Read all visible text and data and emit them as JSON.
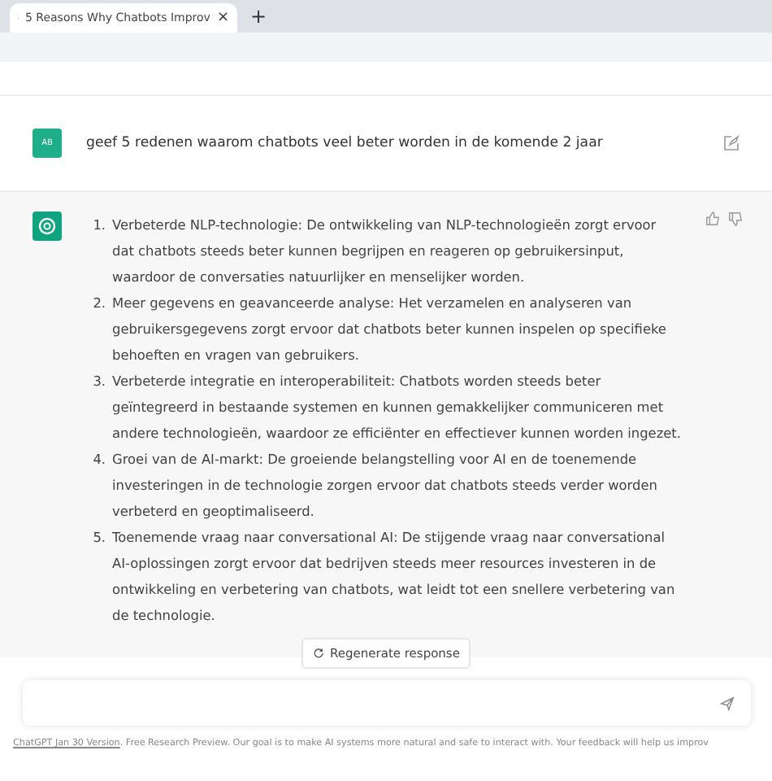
{
  "tab": {
    "title": "5 Reasons Why Chatbots Improv",
    "close": "×",
    "new_tab": "+"
  },
  "user_message": {
    "avatar": "AB",
    "text": "geef 5 redenen waarom chatbots veel beter worden in de komende 2 jaar"
  },
  "answer": {
    "items": [
      {
        "number": "1.",
        "text": "Verbeterde NLP-technologie: De ontwikkeling van NLP-technologieën zorgt ervoor dat chatbots steeds beter kunnen begrijpen en reageren op gebruikersinput, waardoor de conversaties natuurlijker en menselijker worden."
      },
      {
        "number": "2.",
        "text": "Meer gegevens en geavanceerde analyse: Het verzamelen en analyseren van gebruikersgegevens zorgt ervoor dat chatbots beter kunnen inspelen op specifieke behoeften en vragen van gebruikers."
      },
      {
        "number": "3.",
        "text": "Verbeterde integratie en interoperabiliteit: Chatbots worden steeds beter geïntegreerd in bestaande systemen en kunnen gemakkelijker communiceren met andere technologieën, waardoor ze efficiënter en effectiever kunnen worden ingezet."
      },
      {
        "number": "4.",
        "text": "Groei van de AI-markt: De groeiende belangstelling voor AI en de toenemende investeringen in de technologie zorgen ervoor dat chatbots steeds verder worden verbeterd en geoptimaliseerd."
      },
      {
        "number": "5.",
        "text": "Toenemende vraag naar conversational AI: De stijgende vraag naar conversational AI-oplossingen zorgt ervoor dat bedrijven steeds meer resources investeren in de ontwikkeling en verbetering van chatbots, wat leidt tot een snellere verbetering van de technologie."
      }
    ]
  },
  "regenerate_button": "Regenerate response",
  "footer": {
    "link": "ChatGPT Jan 30 Version",
    "text": ". Free Research Preview. Our goal is to make AI systems more natural and safe to interact with. Your feedback will help us improv"
  }
}
